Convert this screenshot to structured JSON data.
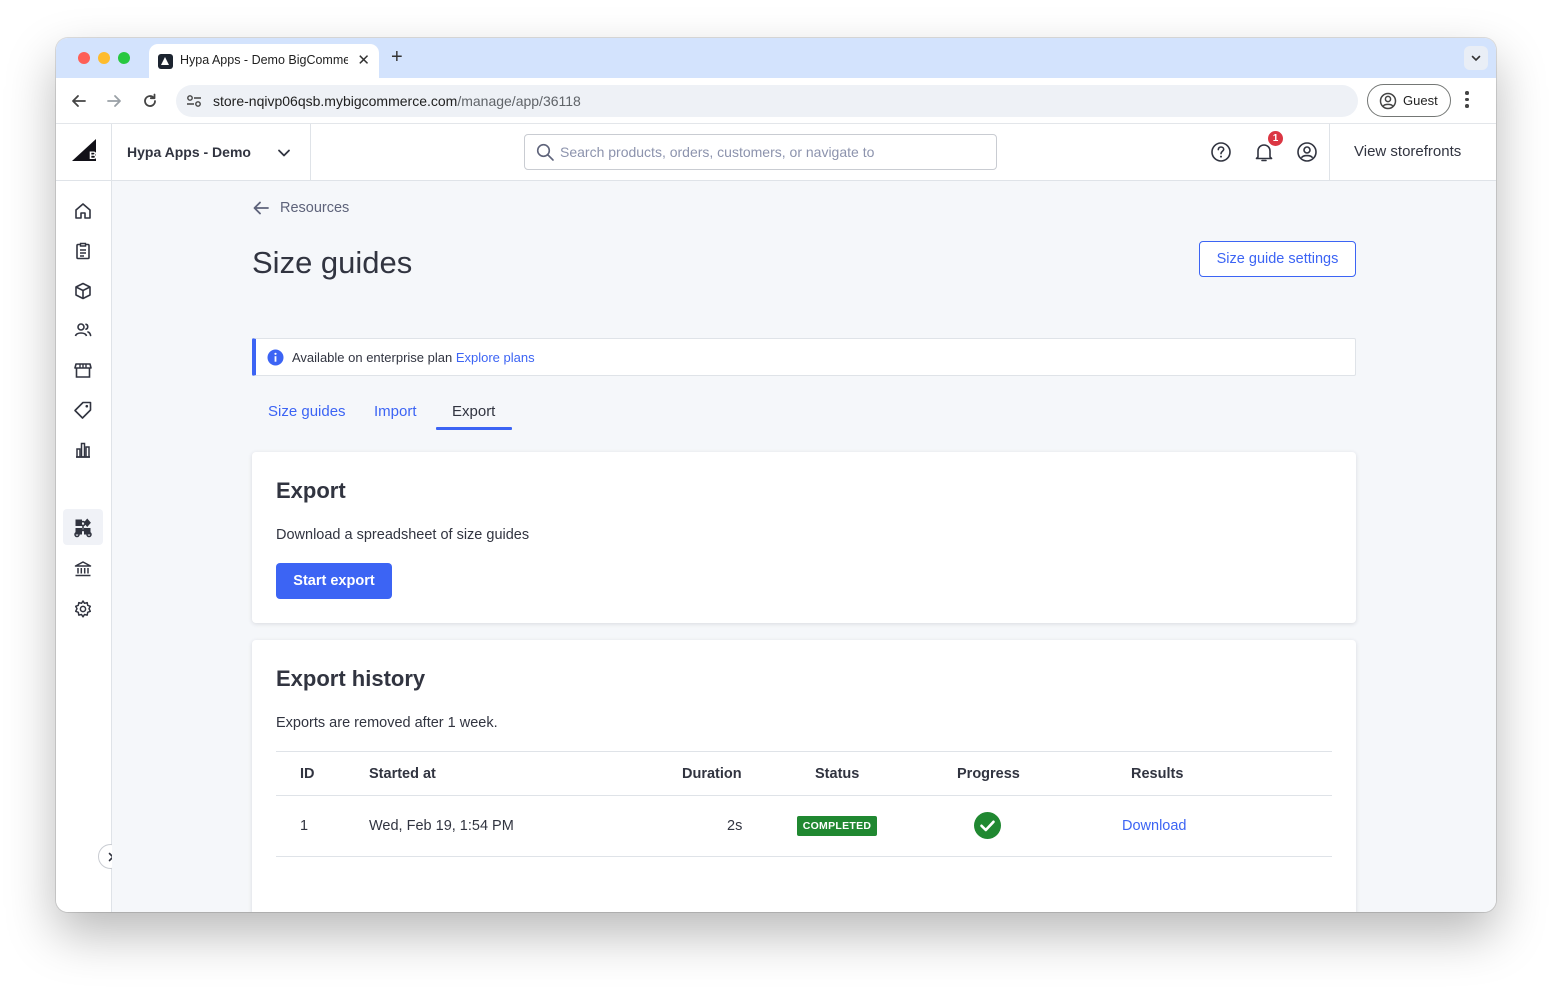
{
  "browser": {
    "tab_title": "Hypa Apps - Demo BigCommerce",
    "url_host": "store-nqivp06qsb.mybigcommerce.com",
    "url_path": "/manage/app/36118",
    "profile_label": "Guest",
    "traffic_colors": [
      "#fe5f57",
      "#febc2e",
      "#28c840"
    ]
  },
  "header": {
    "store_name": "Hypa Apps - Demo",
    "search_placeholder": "Search products, orders, customers, or navigate to",
    "notification_count": "1",
    "view_storefronts": "View storefronts"
  },
  "sidebar": {
    "items": [
      {
        "icon": "home-icon"
      },
      {
        "icon": "orders-icon"
      },
      {
        "icon": "products-icon"
      },
      {
        "icon": "customers-icon"
      },
      {
        "icon": "storefront-icon"
      },
      {
        "icon": "marketing-icon"
      },
      {
        "icon": "analytics-icon"
      },
      {
        "icon": "apps-icon",
        "active": true
      },
      {
        "icon": "channels-icon"
      },
      {
        "icon": "finance-icon"
      },
      {
        "icon": "settings-icon"
      }
    ]
  },
  "page": {
    "back_label": "Resources",
    "title": "Size guides",
    "settings_button": "Size guide settings",
    "info_text": "Available on enterprise plan",
    "info_link": "Explore plans",
    "tabs": [
      "Size guides",
      "Import",
      "Export"
    ],
    "active_tab": "Export"
  },
  "export_card": {
    "title": "Export",
    "description": "Download a spreadsheet of size guides",
    "button": "Start export"
  },
  "history_card": {
    "title": "Export history",
    "description": "Exports are removed after 1 week.",
    "columns": [
      "ID",
      "Started at",
      "Duration",
      "Status",
      "Progress",
      "Results"
    ],
    "rows": [
      {
        "id": "1",
        "started_at": "Wed, Feb 19, 1:54 PM",
        "duration": "2s",
        "status": "COMPLETED",
        "progress": "complete",
        "result_link": "Download"
      }
    ]
  },
  "colors": {
    "accent": "#3c64f4",
    "success": "#208831",
    "badge_red": "#db3643",
    "page_bg": "#f5f7fa"
  }
}
